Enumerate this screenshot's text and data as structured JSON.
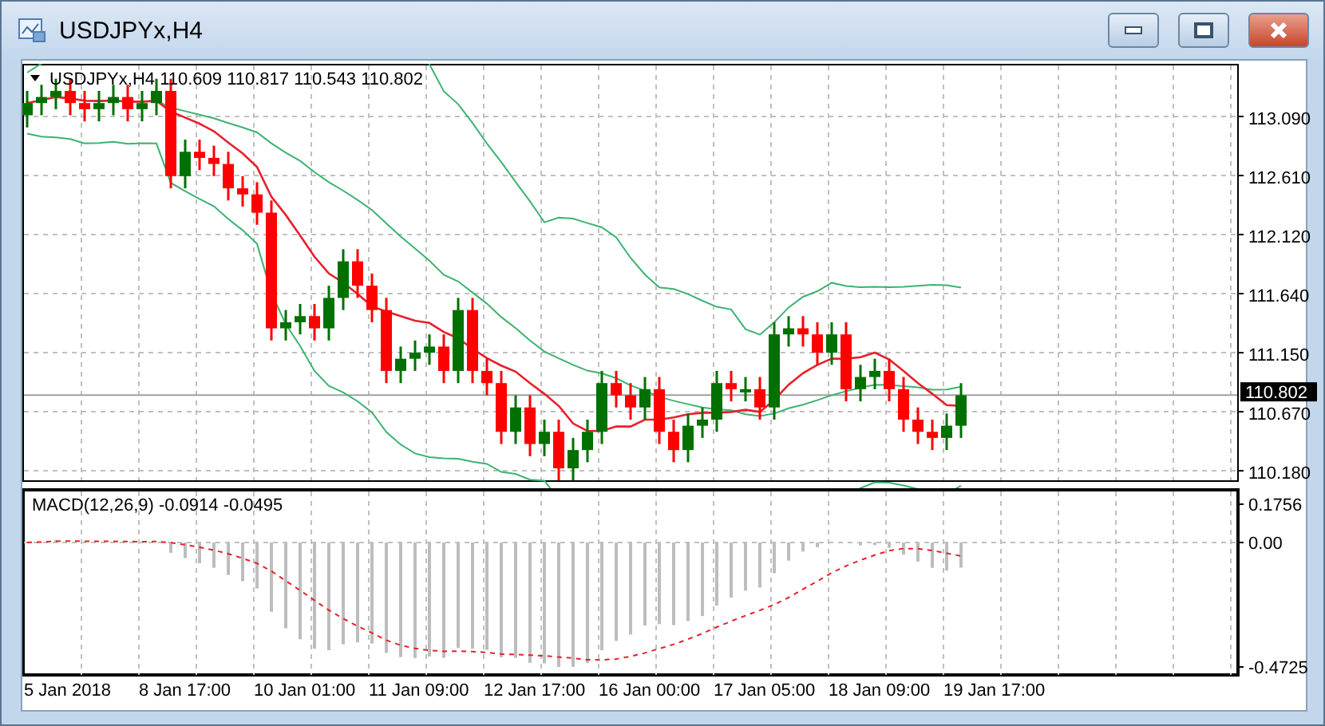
{
  "window": {
    "title": "USDJPYx,H4"
  },
  "main_pane": {
    "legend": "USDJPYx,H4  110.609 110.817 110.543 110.802",
    "price_ticks": [
      "113.090",
      "112.610",
      "112.120",
      "111.640",
      "111.150",
      "110.670",
      "110.180"
    ],
    "current_price": "110.802"
  },
  "macd_pane": {
    "legend": "MACD(12,26,9) -0.0914 -0.0495",
    "ticks": [
      "0.1756",
      "0.00",
      "-0.4725"
    ]
  },
  "time_axis": [
    "5 Jan 2018",
    "8 Jan 17:00",
    "10 Jan 01:00",
    "11 Jan 09:00",
    "12 Jan 17:00",
    "16 Jan 00:00",
    "17 Jan 05:00",
    "18 Jan 09:00",
    "19 Jan 17:00"
  ]
}
